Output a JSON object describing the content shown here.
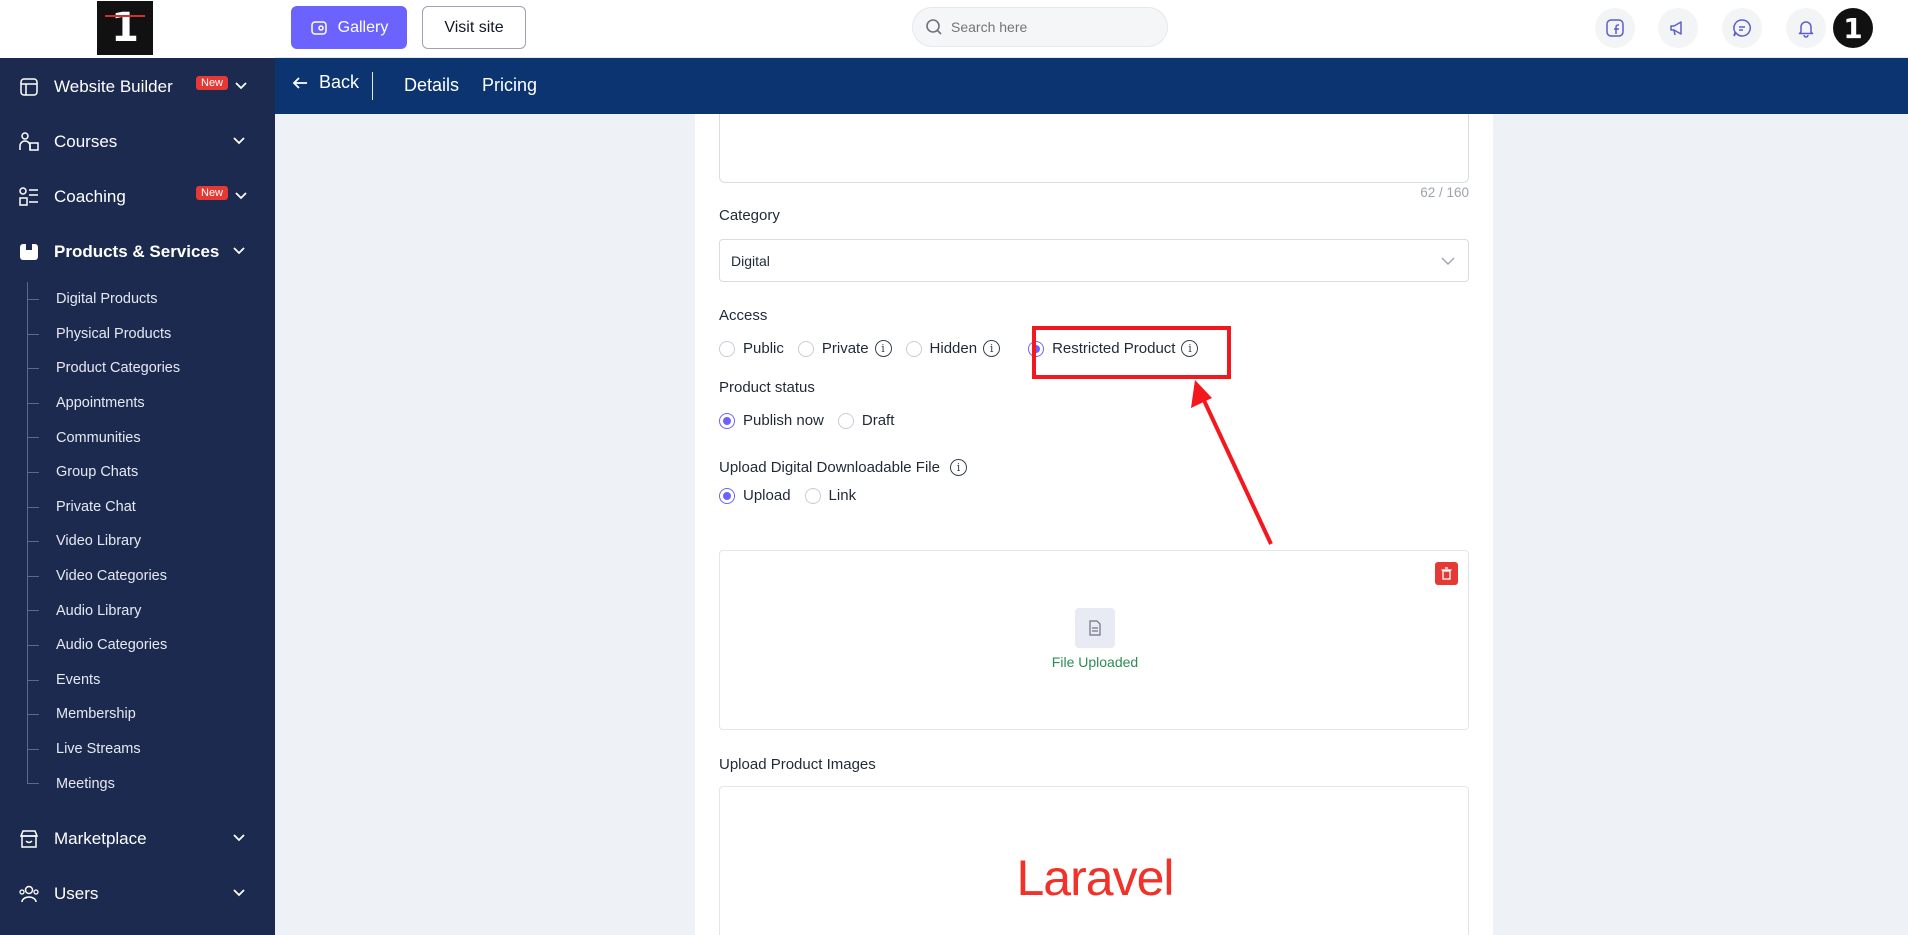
{
  "sidebar": {
    "logo_text": "1",
    "items": [
      {
        "label": "Website Builder",
        "badge": "New"
      },
      {
        "label": "Courses"
      },
      {
        "label": "Coaching",
        "badge": "New"
      },
      {
        "label": "Products & Services"
      },
      {
        "label": "Marketplace"
      },
      {
        "label": "Users"
      }
    ],
    "sub_items": [
      "Digital Products",
      "Physical Products",
      "Product Categories",
      "Appointments",
      "Communities",
      "Group Chats",
      "Private Chat",
      "Video Library",
      "Video Categories",
      "Audio Library",
      "Audio Categories",
      "Events",
      "Membership",
      "Live Streams",
      "Meetings"
    ]
  },
  "topbar": {
    "gallery_label": "Gallery",
    "visit_label": "Visit site",
    "search_placeholder": "Search here",
    "avatar_text": "1"
  },
  "subheader": {
    "back_label": "Back",
    "tabs": [
      "Details",
      "Pricing"
    ]
  },
  "form": {
    "char_counter": "62 / 160",
    "category_label": "Category",
    "category_value": "Digital",
    "access_label": "Access",
    "access_options": [
      "Public",
      "Private",
      "Hidden",
      "Restricted Product"
    ],
    "access_selected": "Restricted Product",
    "status_label": "Product status",
    "status_options": [
      "Publish now",
      "Draft"
    ],
    "status_selected": "Publish now",
    "upload_label": "Upload Digital Downloadable File",
    "upload_options": [
      "Upload",
      "Link"
    ],
    "upload_selected": "Upload",
    "file_status": "File Uploaded",
    "images_label": "Upload Product Images",
    "image_logo_text": "Laravel"
  },
  "colors": {
    "sidebar_bg": "#1b2a4e",
    "subheader_bg": "#0b3470",
    "accent": "#6c63ff",
    "highlight": "#f2181e",
    "success": "#2e8b57"
  },
  "icons": [
    "grid-icon",
    "courses-icon",
    "coaching-icon",
    "box-icon",
    "store-icon",
    "users-icon",
    "chevron-down-icon",
    "search-icon",
    "facebook-icon",
    "megaphone-icon",
    "chat-icon",
    "bell-icon",
    "arrow-left-icon",
    "info-icon",
    "trash-icon",
    "file-icon"
  ]
}
